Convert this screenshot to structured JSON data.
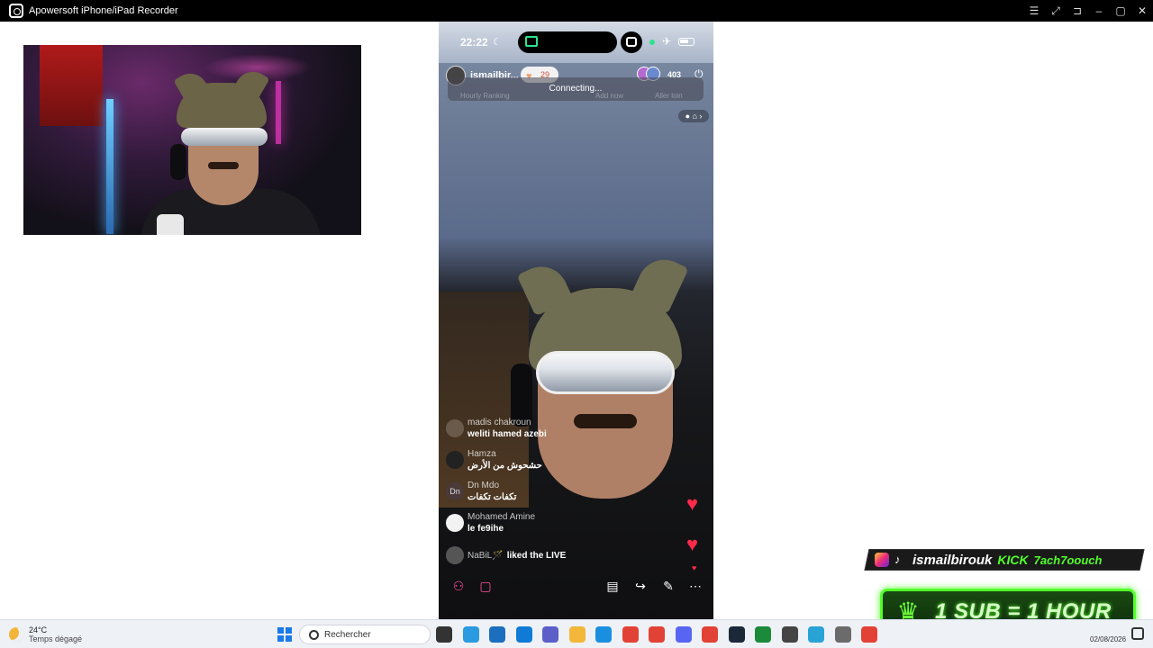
{
  "window": {
    "title": "Apowersoft iPhone/iPad Recorder",
    "controls": [
      "list-icon",
      "fullscreen-icon",
      "pin-icon",
      "minimize-icon",
      "maximize-icon",
      "close-icon"
    ],
    "control_glyphs": [
      "☰",
      "⤢",
      "⊐",
      "–",
      "▢",
      "✕"
    ]
  },
  "phone": {
    "status": {
      "time": "22:22",
      "moon": "☾",
      "airplane": "✈"
    },
    "live": {
      "host_name": "ismailbir...",
      "likes": "29",
      "viewers": "403",
      "connecting": "Connecting...",
      "ranking_left": "Hourly Ranking",
      "ranking_mid": "Add now",
      "ranking_right": "Aller loin"
    },
    "comments": [
      {
        "avatar": "",
        "user": "madis chakroun",
        "text": "weliti hamed azebi"
      },
      {
        "avatar": "",
        "user": "Hamza",
        "text": "حشحوش من الأرض"
      },
      {
        "avatar": "Dn",
        "user": "Dn Mdo",
        "text": "تكفات تكفات"
      },
      {
        "avatar": "",
        "user": "Mohamed Amine",
        "text": "le fe9ihe"
      }
    ],
    "liked": {
      "user": "NaBiL🪄",
      "text": "liked the LIVE"
    },
    "hearts": [
      "♥",
      "♥",
      "♥"
    ]
  },
  "overlay": {
    "social_handle": "ismailbirouk",
    "kick_label": "KICK",
    "kick_handle": "7ach7oouch",
    "sub_text": "1 SUB = 1 HOUR"
  },
  "taskbar": {
    "temperature": "24°C",
    "condition": "Temps dégagé",
    "search_placeholder": "Rechercher",
    "date": "02/08/2026",
    "app_colors": [
      "#333333",
      "#2a9be0",
      "#1c6fbf",
      "#0f7bd6",
      "#5b5fc7",
      "#f3b73a",
      "#1a8fe0",
      "#e24235",
      "#e24235",
      "#5865f2",
      "#e24235",
      "#1b2838",
      "#1c8a3a",
      "#444444",
      "#29a3d6",
      "#6b6b6b",
      "#e24235"
    ]
  }
}
